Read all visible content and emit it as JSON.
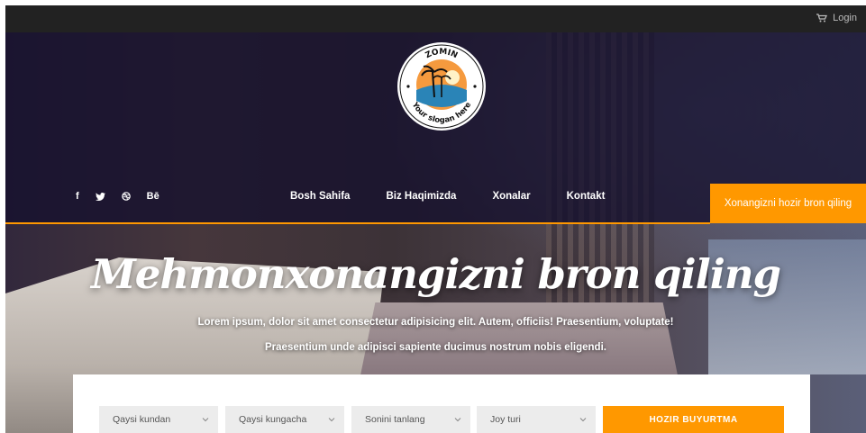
{
  "topbar": {
    "login_label": "Login",
    "cart_icon": "cart-icon"
  },
  "logo": {
    "brand": "ZOMIN",
    "slogan": "Your slogan here"
  },
  "social": {
    "items": [
      "f",
      "twitter",
      "dribbble",
      "Bē"
    ]
  },
  "nav": {
    "items": [
      "Bosh Sahifa",
      "Biz Haqimizda",
      "Xonalar",
      "Kontakt"
    ],
    "cta_label": "Xonangizni hozir bron qiling"
  },
  "hero": {
    "headline": "Mehmonxonangizni bron qiling",
    "subtext_line1": "Lorem ipsum, dolor sit amet consectetur adipisicing elit. Autem, officiis! Praesentium, voluptate!",
    "subtext_line2": "Praesentium unde adipisci sapiente ducimus nostrum nobis eligendi."
  },
  "booking": {
    "fields": [
      "Qaysi kundan",
      "Qaysi kungacha",
      "Sonini tanlang",
      "Joy turi"
    ],
    "submit_label": "HOZIR BUYURTMA"
  },
  "colors": {
    "accent": "#ff9800",
    "topbar": "#222222",
    "overlay": "#14102d"
  }
}
